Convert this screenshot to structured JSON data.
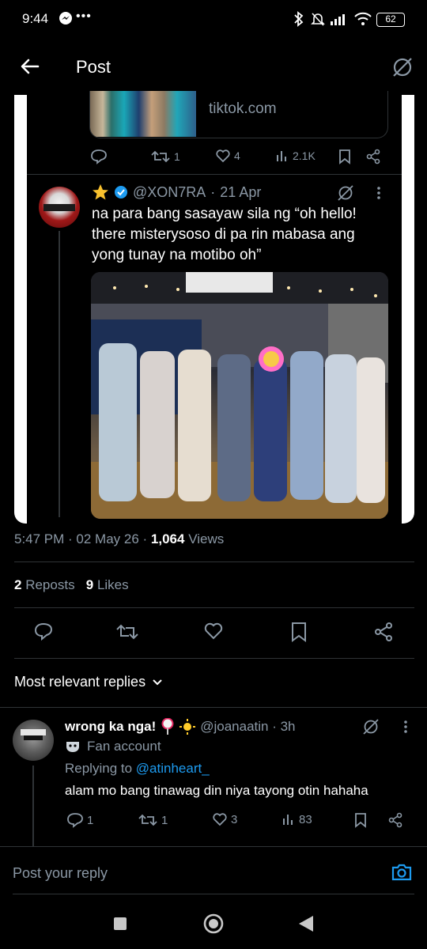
{
  "status": {
    "time": "9:44",
    "dots": "•••",
    "battery": "62"
  },
  "header": {
    "title": "Post"
  },
  "quoted_link": {
    "domain": "tiktok.com"
  },
  "quoted_actions": {
    "retweets": "1",
    "likes": "4",
    "views": "2.1K"
  },
  "quote_post": {
    "handle": "@XON7RA",
    "dot": "·",
    "date": "21 Apr",
    "body": "na para bang sasayaw sila ng “oh hello! there misterysoso di pa rin mabasa ang yong tunay na motibo oh”"
  },
  "post_meta": {
    "time": "5:47 PM · 02 May 26 ·",
    "views_count": "1,064",
    "views_label": "Views"
  },
  "post_counts": {
    "reposts_count": "2",
    "reposts_label": "Reposts",
    "likes_count": "9",
    "likes_label": "Likes"
  },
  "replies_filter": {
    "label": "Most relevant replies"
  },
  "reply": {
    "name": "wrong ka nga!",
    "handle": "@joanaatin · 3h",
    "badge": "Fan account",
    "replying_prefix": "Replying to",
    "replying_to": "@atinheart_",
    "body": "alam mo bang tinawag din niya tayong otin hahaha",
    "replies": "1",
    "retweets": "1",
    "likes": "3",
    "views": "83"
  },
  "composer": {
    "placeholder": "Post your reply"
  },
  "colors": {
    "accent": "#1d9bf0",
    "muted": "#8b98a5",
    "divider": "#2f3336"
  }
}
